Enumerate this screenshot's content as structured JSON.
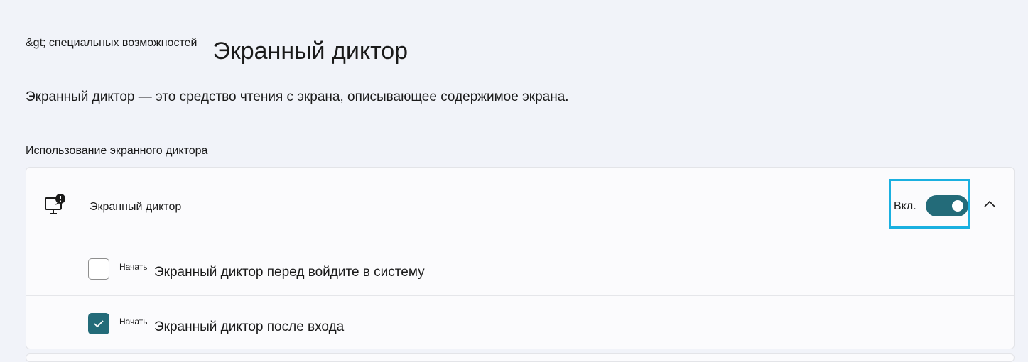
{
  "header": {
    "breadcrumb_parent": "&gt; специальных возможностей",
    "title": "Экранный диктор"
  },
  "description": "Экранный диктор — это средство чтения с экрана, описывающее содержимое экрана.",
  "section": {
    "heading": "Использование экранного диктора"
  },
  "narrator_card": {
    "icon": "narrator-icon",
    "label": "Экранный диктор",
    "toggle": {
      "state_label": "Вкл.",
      "on": true,
      "color": "#236b79"
    },
    "expand_icon": "chevron-up-icon",
    "highlight_color": "#1ab0e0",
    "options": [
      {
        "prefix": "Начать",
        "label": "Экранный диктор перед войдите в систему",
        "checked": false
      },
      {
        "prefix": "Начать",
        "label": "Экранный диктор после входа",
        "checked": true
      }
    ]
  }
}
